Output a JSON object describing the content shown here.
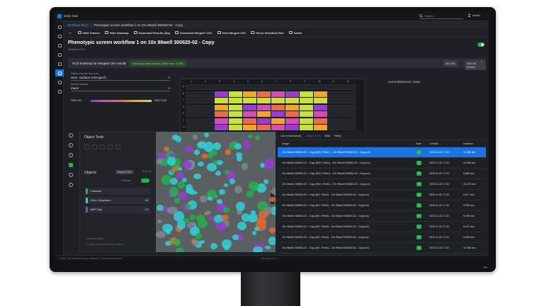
{
  "app": {
    "name": "arivis Hub"
  },
  "search": {
    "placeholder": "Search..."
  },
  "user": {
    "name": "admin"
  },
  "breadcrumb": {
    "root": "Workflow Runs",
    "separator": "/",
    "current": "Phenotypic screen workflow 1 on 10x 96well 300620-02 - Copy"
  },
  "toolbar": {
    "items": [
      "Hide Frames",
      "Hide Heatmap",
      "Download Results (Zip)",
      "Download Merged* CSV",
      "View Merged CSV",
      "Rerun Workflow Run",
      "Delete"
    ]
  },
  "page": {
    "title": "Phenotypic screen workflow 1 on 10x 96well 300620-02 - Copy",
    "subtitle": "Workflow Run"
  },
  "heatmap": {
    "header": "HCS heatmap for merged CSV results",
    "note": "Heatmap data loaded (Table size: 4 MB)",
    "export_csv": "All CSV",
    "export_all": "All CSV (DWS)",
    "column_label": "Select column from csv",
    "column_value": "Sum: Surface Area (µm²)",
    "method_label": "Select method",
    "method_value": "mean",
    "scale_min": "3984.269",
    "scale_max": "18907.6.89",
    "current_selection": "currentSelection: none",
    "columns": [
      "1",
      "2",
      "3",
      "4",
      "5",
      "6",
      "7",
      "8",
      "9",
      "10",
      "11",
      "12"
    ],
    "rows": [
      "A",
      "B",
      "C",
      "D",
      "E",
      "F",
      "G",
      "H"
    ]
  },
  "object_tools": {
    "title": "Object Tools",
    "objects_label": "Objects",
    "export_csv": "Export CSV",
    "add": "Add Op",
    "combine_label": "Combine",
    "items": [
      {
        "name": "Channels",
        "count": "",
        "color": "#22b14c"
      },
      {
        "name": "Green Cytoplasm",
        "count": "160",
        "color": "#2fd0d8"
      },
      {
        "name": "DAPI Seg",
        "count": "174",
        "color": "#9b3bd6"
      }
    ],
    "footer_1": "Generate tooltip",
    "footer_2": "Loading complete with 922 objects"
  },
  "runs": {
    "title": "List of executions",
    "compare": "Analyze VIS",
    "view": "View",
    "retry": "Retry",
    "columns": {
      "image": "Image",
      "state": "State",
      "created": "Created",
      "duration": "Duration"
    },
    "rows": [
      {
        "image": "10x 96well 300620-02 - Copy (B10, Field1) - 10x 96well 300620-02 - Copy.czi)",
        "created": "2023-11-02 17:22",
        "duration": "11.850 sec",
        "selected": true
      },
      {
        "image": "10x 96well 300620-02 - Copy (B10, Field1) - 10x 96well 300620-02 - Copy.czi)",
        "created": "2023-11-02 17:22",
        "duration": "11.805 sec",
        "selected": false
      },
      {
        "image": "10x 96well 300620-02 - Copy (B10, Field1) - 10x 96well 300620-02 - Copy.czi)",
        "created": "2023-11-02 17:22",
        "duration": "9.865 sec",
        "selected": false
      },
      {
        "image": "10x 96well 300620-02 - Copy (B10, Field1) - 10x 96well 300620-02 - Copy.czi)",
        "created": "2023-11-02 17:22",
        "duration": "10.470 sec",
        "selected": false
      },
      {
        "image": "10x 96well 300620-02 - Copy (B1, Field1) - 10x 96well 300620-02 - Copy.czi)",
        "created": "2023-11-02 17:22",
        "duration": "8.877 sec",
        "selected": false
      },
      {
        "image": "10x 96well 300620-02 - Copy (B1, Field1) - 10x 96well 300620-02 - Copy.czi)",
        "created": "2023-11-02 17:22",
        "duration": "9.290 sec",
        "selected": false
      },
      {
        "image": "10x 96well 300620-02 - Copy (B1, Field3) - 10x 96well 300620-02 - Copy.czi)",
        "created": "2023-11-02 17:22",
        "duration": "9.199 sec",
        "selected": false
      },
      {
        "image": "10x 96well 300620-02 - Copy (B1, Field4) - 10x 96well 300620-02 - Copy.czi)",
        "created": "2023-11-02 17:22",
        "duration": "9.121 sec",
        "selected": false
      },
      {
        "image": "10x 96well 300620-02 - Copy (B1, Field1) - 10x 96well 300620-02 - Copy.czi)",
        "created": "2023-11-02 17:22",
        "duration": "9.636 sec",
        "selected": false
      },
      {
        "image": "10x 96well 300620-02 - Copy (B1, Field1) - 10x 96well 300620-02 - Copy.czi)",
        "created": "2023-11-02 17:22",
        "duration": "10.280 sec",
        "selected": false
      }
    ]
  },
  "footer": {
    "copyright": "© 2023 Carl Zeiss Microscopy Software Center Rostock GmbH",
    "version": "arivis Hub v4.1.x"
  },
  "colors": {
    "accent": "#1b74e4",
    "ok": "#22b14c",
    "scale": [
      "#9b3bd6",
      "#d84ab8",
      "#ee6a4e",
      "#f5a623",
      "#c7e33a"
    ]
  }
}
